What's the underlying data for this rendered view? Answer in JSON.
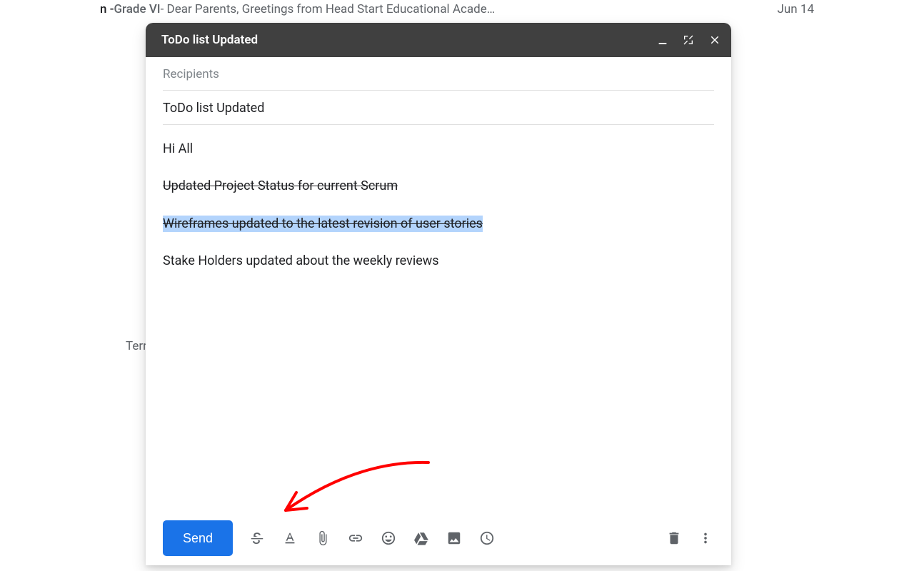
{
  "background": {
    "email_row": {
      "subject_prefix": "n - ",
      "subject_bold": "Grade VI",
      "preview": " - Dear Parents, Greetings from Head Start Educational Acade…",
      "date": "Jun 14"
    },
    "partial_text": "Terr"
  },
  "compose": {
    "title": "ToDo list Updated",
    "recipients_placeholder": "Recipients",
    "subject": "ToDo list Updated",
    "body": {
      "line1": "Hi All",
      "line2": "Updated Project Status for current Scrum ",
      "line3": "Wireframes updated to the latest revision of user stories",
      "line4": "Stake Holders updated about the weekly reviews"
    },
    "toolbar": {
      "send_label": "Send"
    }
  }
}
